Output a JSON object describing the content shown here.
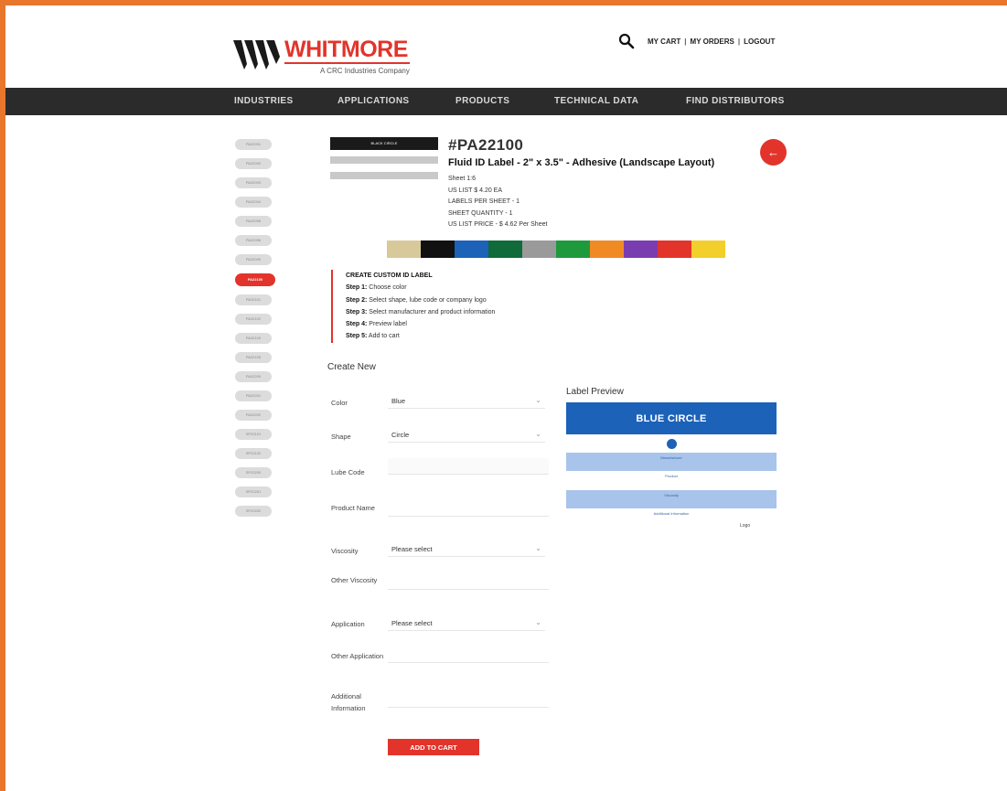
{
  "brand": {
    "name": "WHITMORE",
    "tagline": "A CRC Industries Company",
    "accent": "#e2342b"
  },
  "utility": {
    "cart": "MY CART",
    "orders": "MY ORDERS",
    "logout": "LOGOUT",
    "sep": "|"
  },
  "nav": [
    "INDUSTRIES",
    "APPLICATIONS",
    "PRODUCTS",
    "TECHNICAL DATA",
    "FIND DISTRIBUTORS"
  ],
  "sidebar": {
    "items": [
      "PA22091",
      "PA22092",
      "PA22093",
      "PA22094",
      "PA22095",
      "PA22096",
      "PA22099",
      "PA22100",
      "PA22101",
      "PA22102",
      "PA22103",
      "PA22105",
      "PA22200",
      "PA22201",
      "PA22202",
      "SP22101",
      "SP22102",
      "SP22200",
      "SP22201",
      "SP22202"
    ],
    "active_index": 7
  },
  "product": {
    "thumb_title": "BLACK CIRCLE",
    "id": "#PA22100",
    "title": "Fluid ID Label - 2\" x 3.5\" - Adhesive (Landscape Layout)",
    "meta": [
      "Sheet 1:6",
      "US LIST $ 4.20 EA",
      "LABELS PER SHEET - 1",
      "SHEET QUANTITY - 1",
      "US LIST PRICE - $ 4.62 Per Sheet"
    ]
  },
  "swatches": [
    "#d8c99a",
    "#111111",
    "#1b62b8",
    "#0f6b3a",
    "#9a9a9a",
    "#1e9a3c",
    "#f08a24",
    "#7a3db0",
    "#e2342b",
    "#f2cf2a"
  ],
  "steps": {
    "heading": "CREATE CUSTOM ID LABEL",
    "items": [
      {
        "label": "Step 1:",
        "text": "Choose color"
      },
      {
        "label": "Step 2:",
        "text": "Select shape, lube code or company logo"
      },
      {
        "label": "Step 3:",
        "text": "Select manufacturer and product information"
      },
      {
        "label": "Step 4:",
        "text": "Preview label"
      },
      {
        "label": "Step 5:",
        "text": "Add to cart"
      }
    ]
  },
  "form": {
    "title": "Create New",
    "color_label": "Color",
    "color_value": "Blue",
    "shape_label": "Shape",
    "shape_value": "Circle",
    "lube_label": "Lube Code",
    "product_label": "Product Name",
    "viscosity_label": "Viscosity",
    "viscosity_value": "Please select",
    "other_viscosity_label": "Other Viscosity",
    "application_label": "Application",
    "application_value": "Please select",
    "other_application_label": "Other Application",
    "additional_label": "Additional Information",
    "add_to_cart": "ADD TO CART"
  },
  "preview": {
    "title": "Label Preview",
    "banner": "BLUE CIRCLE",
    "bar1_text": "Manufacturer",
    "cap1": "Product",
    "bar2_text": "Viscosity",
    "cap2": "Additional Information",
    "logo_alt": "Logo"
  }
}
